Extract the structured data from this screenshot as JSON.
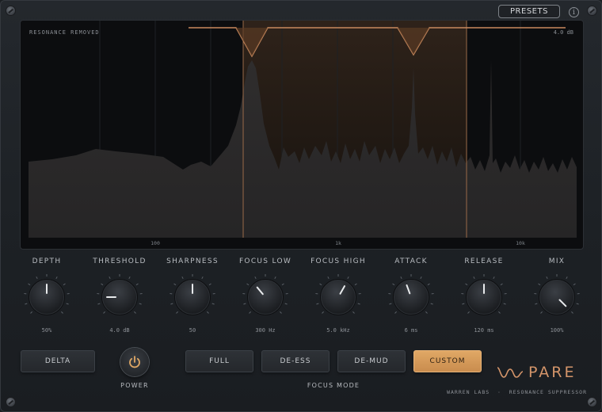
{
  "header": {
    "presets_label": "PRESETS",
    "info_label": "i"
  },
  "display": {
    "title": "RESONANCE REMOVED",
    "db_readout": "4.0 dB",
    "freq_labels": [
      "100",
      "1k",
      "10k"
    ]
  },
  "knobs": [
    {
      "id": "depth",
      "label": "DEPTH",
      "value": "50%",
      "angle": 0
    },
    {
      "id": "threshold",
      "label": "THRESHOLD",
      "value": "4.0 dB",
      "angle": -90
    },
    {
      "id": "sharpness",
      "label": "SHARPNESS",
      "value": "50",
      "angle": 0
    },
    {
      "id": "focus-low",
      "label": "FOCUS LOW",
      "value": "300 Hz",
      "angle": -40
    },
    {
      "id": "focus-high",
      "label": "FOCUS HIGH",
      "value": "5.0 kHz",
      "angle": 30
    },
    {
      "id": "attack",
      "label": "ATTACK",
      "value": "6 ms",
      "angle": -20
    },
    {
      "id": "release",
      "label": "RELEASE",
      "value": "120 ms",
      "angle": 0
    },
    {
      "id": "mix",
      "label": "MIX",
      "value": "100%",
      "angle": 135
    }
  ],
  "controls": {
    "delta_label": "DELTA",
    "power_label": "POWER",
    "focus_mode_label": "FOCUS MODE",
    "focus_modes": [
      {
        "label": "FULL",
        "active": false
      },
      {
        "label": "DE-ESS",
        "active": false
      },
      {
        "label": "DE-MUD",
        "active": false
      },
      {
        "label": "CUSTOM",
        "active": true
      }
    ]
  },
  "brand": {
    "name": "PARE",
    "maker": "WARREN LABS",
    "separator": "·",
    "product": "RESONANCE SUPPRESSOR"
  },
  "colors": {
    "accent": "#d4956a",
    "button_active": "#d99a5b",
    "background": "#1f2327",
    "display_bg": "#0c0d0f"
  },
  "icons": {
    "power": "power-icon",
    "info": "info-icon",
    "logo": "wave-logo-icon"
  }
}
